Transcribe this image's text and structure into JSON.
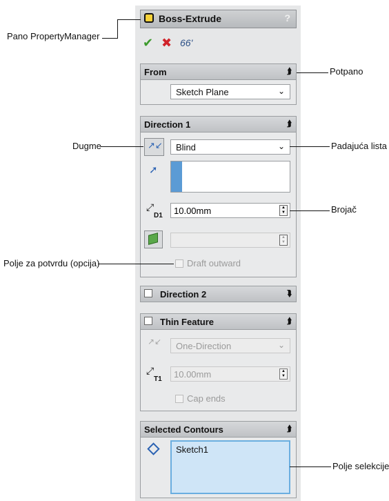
{
  "property_manager": {
    "title": "Boss-Extrude",
    "help_label": "?",
    "actions": {
      "ok_icon": "✔",
      "cancel_icon": "✖",
      "preview_icon": "66'"
    },
    "from_group": {
      "title": "From",
      "selected": "Sketch Plane"
    },
    "direction1": {
      "title": "Direction 1",
      "end_condition": "Blind",
      "depth_value": "10.00mm",
      "depth_icon_label": "D1",
      "draft_outward_label": "Draft outward"
    },
    "direction2": {
      "title": "Direction 2"
    },
    "thin_feature": {
      "title": "Thin Feature",
      "type": "One-Direction",
      "thickness_value": "10.00mm",
      "thickness_icon_label": "T1",
      "cap_ends_label": "Cap ends"
    },
    "selected_contours": {
      "title": "Selected Contours",
      "item": "Sketch1"
    }
  },
  "callouts": {
    "property_manager": "Pano PropertyManager",
    "subpanel": "Potpano",
    "button": "Dugme",
    "dropdown": "Padajuća lista",
    "spinner": "Brojač",
    "checkbox": "Polje za potvrdu (opcija)",
    "selection_box": "Polje selekcije"
  },
  "colors": {
    "selection_bg": "#cfe5f7",
    "selection_border": "#6aaee0",
    "accent_blue": "#2c63b3"
  }
}
